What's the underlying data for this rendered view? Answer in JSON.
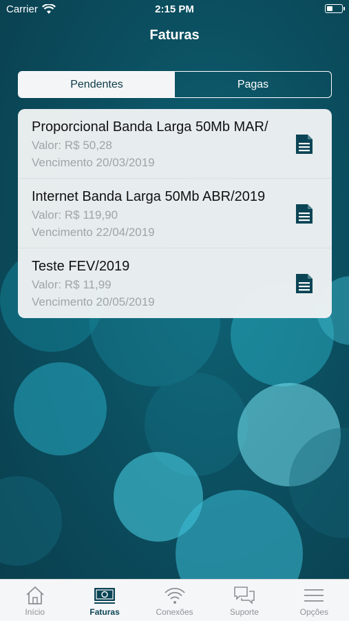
{
  "status_bar": {
    "carrier": "Carrier",
    "time": "2:15 PM"
  },
  "header": {
    "title": "Faturas"
  },
  "segments": {
    "pending": "Pendentes",
    "paid": "Pagas",
    "selected": "Pendentes"
  },
  "invoices": [
    {
      "name": "Proporcional Banda Larga 50Mb MAR/",
      "valor": "Valor: R$ 50,28",
      "vencimento": "Vencimento 20/03/2019"
    },
    {
      "name": "Internet Banda Larga 50Mb ABR/2019",
      "valor": "Valor: R$ 119,90",
      "vencimento": "Vencimento 22/04/2019"
    },
    {
      "name": "Teste FEV/2019",
      "valor": "Valor: R$ 11,99",
      "vencimento": "Vencimento 20/05/2019"
    }
  ],
  "tabbar": {
    "items": [
      {
        "label": "Início",
        "icon": "home-icon"
      },
      {
        "label": "Faturas",
        "icon": "bill-icon"
      },
      {
        "label": "Conexões",
        "icon": "wifi-icon"
      },
      {
        "label": "Suporte",
        "icon": "chat-icon"
      },
      {
        "label": "Opções",
        "icon": "menu-icon"
      }
    ],
    "active": "Faturas"
  },
  "colors": {
    "primary": "#0b4455",
    "inactive": "#8d9194",
    "card": "#f0f3f4"
  }
}
